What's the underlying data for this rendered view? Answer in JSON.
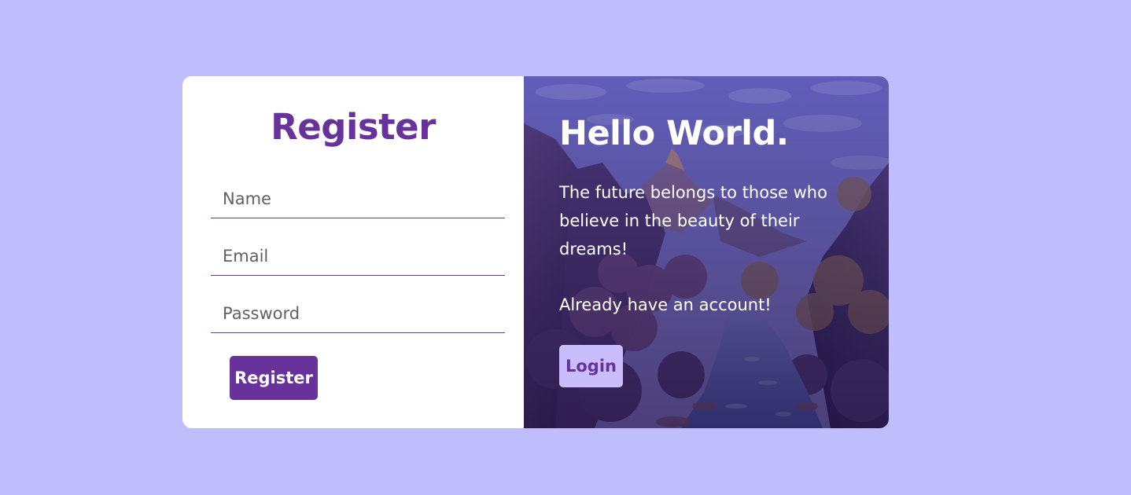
{
  "register": {
    "title": "Register",
    "fields": {
      "name_placeholder": "Name",
      "email_placeholder": "Email",
      "password_placeholder": "Password"
    },
    "button_label": "Register"
  },
  "welcome": {
    "heading": "Hello World.",
    "quote": "The future belongs to those who believe in the beauty of their dreams!",
    "prompt": "Already have an account!",
    "login_label": "Login",
    "background_image": "canyon-river-landscape"
  },
  "colors": {
    "page_background": "#c0bdfd",
    "primary": "#67339b",
    "login_button": "#c9bdfb"
  }
}
